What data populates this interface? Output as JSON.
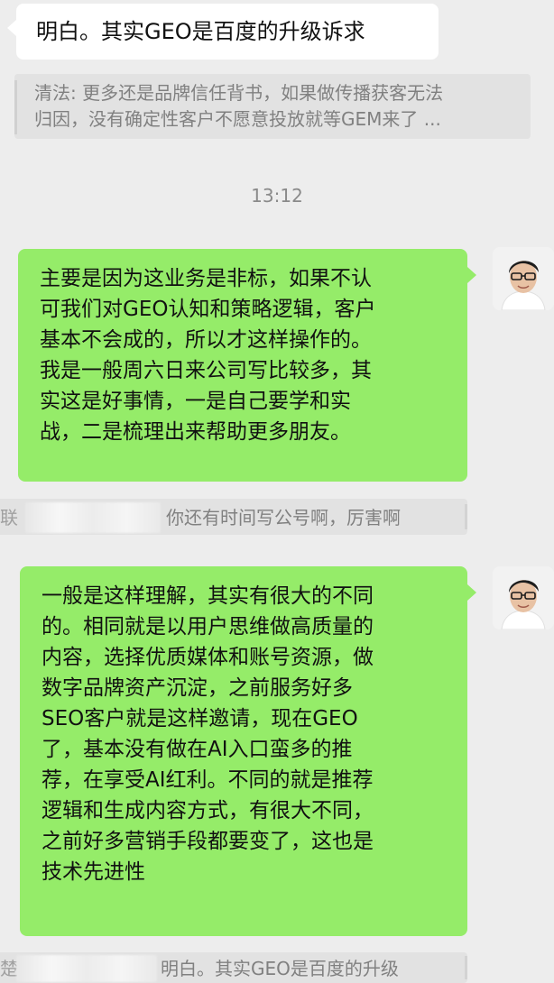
{
  "messages": {
    "incoming_1": "明白。其实GEO是百度的升级诉求",
    "quote_1_line1": "清法: 更多还是品牌信任背书，如果做传播获客无法",
    "quote_1_line2": "归因，没有确定性客户不愿意投放就等GEM来了 ...",
    "timestamp": "13:12",
    "outgoing_1_lines": [
      "主要是因为这业务是非标，如果不认",
      "可我们对GEO认知和策略逻辑，客户",
      "基本不会成的，所以才这样操作的。",
      "我是一般周六日来公司写比较多，其",
      "实这是好事情，一是自己要学和实",
      "战，二是梳理出来帮助更多朋友。"
    ],
    "quote_2_prefix": "联",
    "quote_2_text": "你还有时间写公号啊，厉害啊",
    "outgoing_2_lines": [
      "一般是这样理解，其实有很大的不同",
      "的。相同就是以用户思维做高质量的",
      "内容，选择优质媒体和账号资源，做",
      "数字品牌资产沉淀，之前服务好多",
      "SEO客户就是这样邀请，现在GEO",
      "了，基本没有做在AI入口蛮多的推",
      "荐，在享受AI红利。不同的就是推荐",
      "逻辑和生成内容方式，有很大不同，",
      "之前好多营销手段都要变了，这也是",
      "技术先进性"
    ],
    "quote_3_prefix": "楚",
    "quote_3_text": "明白。其实GEO是百度的升级"
  },
  "colors": {
    "background": "#ededed",
    "incoming_bubble": "#ffffff",
    "outgoing_bubble": "#95ec69",
    "quote_background": "#e2e2e2",
    "quote_text": "#808080"
  },
  "icons": {
    "avatar": "user-avatar-icon"
  }
}
